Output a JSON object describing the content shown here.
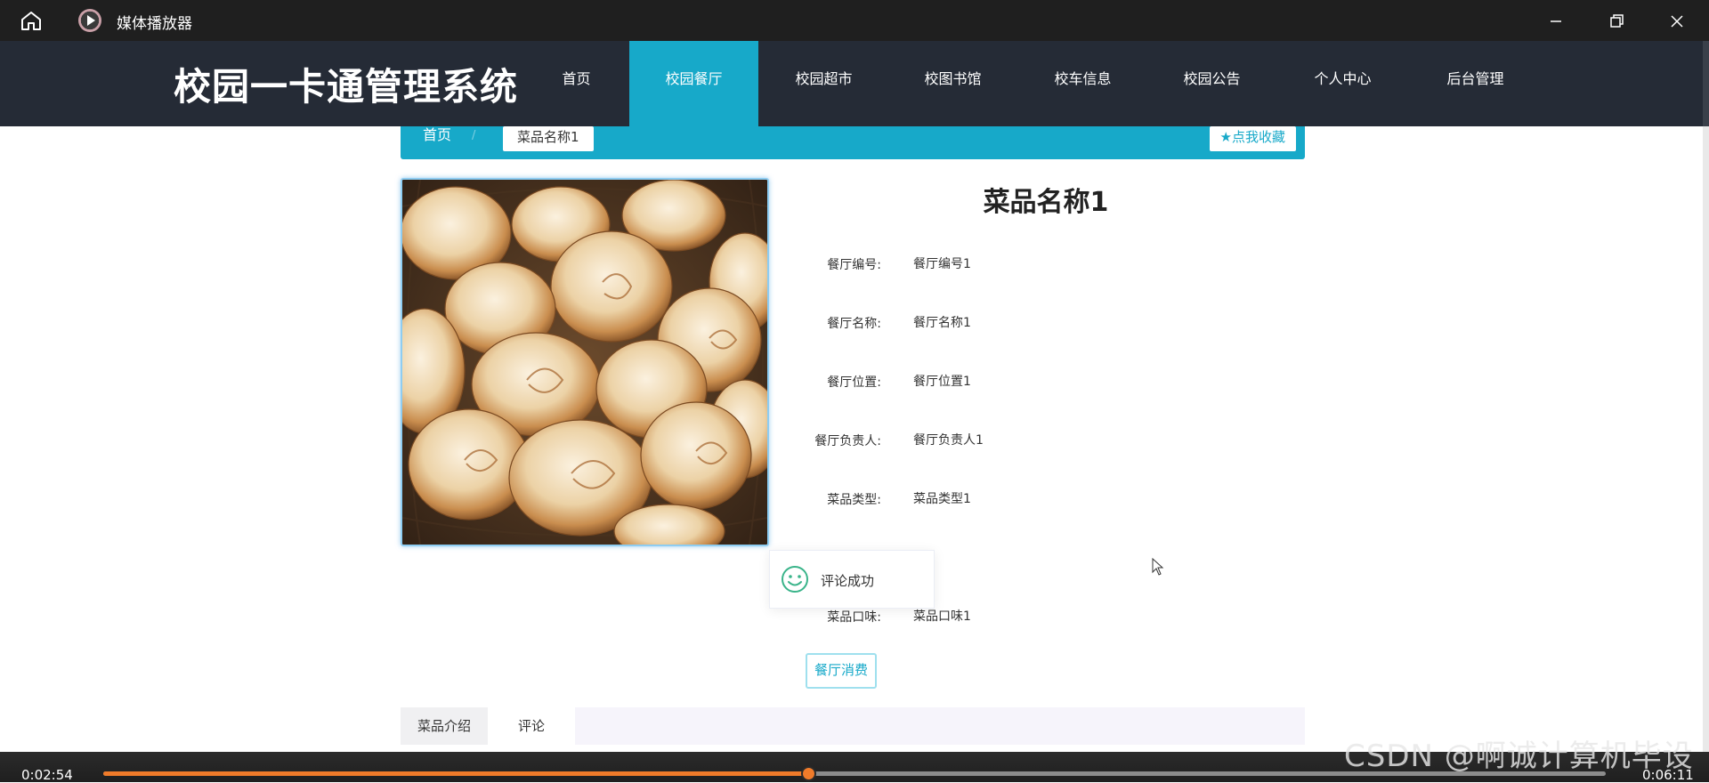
{
  "player": {
    "app_title": "媒体播放器",
    "time_current": "0:02:54",
    "time_total": "0:06:11",
    "progress_fraction": 0.469,
    "accent": "#f07b2a"
  },
  "site": {
    "title": "校园一卡通管理系统",
    "nav": [
      "首页",
      "校园餐厅",
      "校园超市",
      "校图书馆",
      "校车信息",
      "校园公告",
      "个人中心",
      "后台管理"
    ],
    "active_nav": "校园餐厅",
    "accent": "#17a9c9",
    "header_bg": "#252b36"
  },
  "breadcrumb": {
    "home": "首页",
    "separator": "/",
    "current": "菜品名称1",
    "favorite": "★点我收藏"
  },
  "dish": {
    "name": "菜品名称1",
    "image": "baked-buns-in-basket",
    "fields": [
      {
        "label": "餐厅编号:",
        "value": "餐厅编号1"
      },
      {
        "label": "餐厅名称:",
        "value": "餐厅名称1"
      },
      {
        "label": "餐厅位置:",
        "value": "餐厅位置1"
      },
      {
        "label": "餐厅负责人:",
        "value": "餐厅负责人1"
      },
      {
        "label": "菜品类型:",
        "value": "菜品类型1"
      },
      {
        "label": "菜品口味:",
        "value": "菜品口味1"
      }
    ],
    "consume_button": "餐厅消费"
  },
  "toast": {
    "message": "评论成功",
    "icon": "smile-icon"
  },
  "tabs": [
    "菜品介绍",
    "评论"
  ],
  "watermark": "CSDN @啊诚计算机毕设"
}
